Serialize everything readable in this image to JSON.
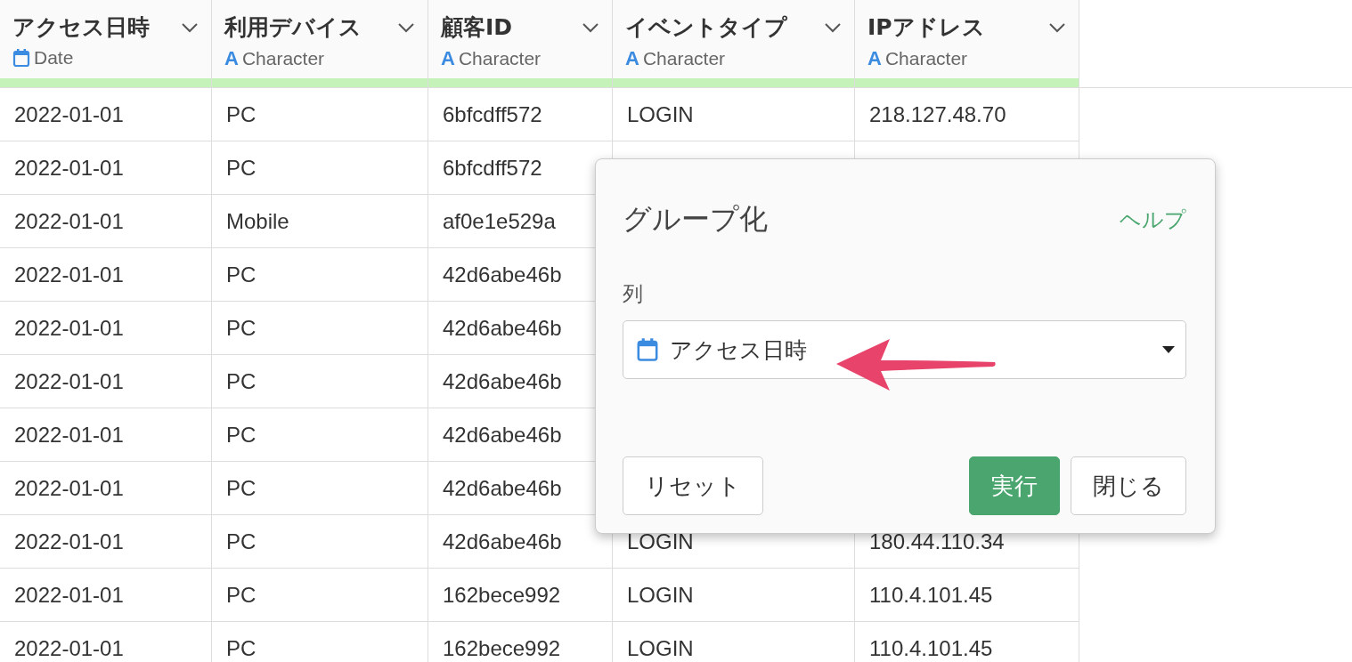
{
  "table": {
    "columns": [
      {
        "label": "アクセス日時",
        "type": "Date",
        "kind": "date"
      },
      {
        "label": "利用デバイス",
        "type": "Character",
        "kind": "character",
        "type_icon": "A"
      },
      {
        "label": "顧客ID",
        "type": "Character",
        "kind": "character",
        "type_icon": "A"
      },
      {
        "label": "イベントタイプ",
        "type": "Character",
        "kind": "character",
        "type_icon": "A"
      },
      {
        "label": "IPアドレス",
        "type": "Character",
        "kind": "character",
        "type_icon": "A"
      }
    ],
    "rows": [
      [
        "2022-01-01",
        "PC",
        "6bfcdff572",
        "LOGIN",
        "218.127.48.70"
      ],
      [
        "2022-01-01",
        "PC",
        "6bfcdff572"
      ],
      [
        "2022-01-01",
        "Mobile",
        "af0e1e529a"
      ],
      [
        "2022-01-01",
        "PC",
        "42d6abe46b"
      ],
      [
        "2022-01-01",
        "PC",
        "42d6abe46b"
      ],
      [
        "2022-01-01",
        "PC",
        "42d6abe46b"
      ],
      [
        "2022-01-01",
        "PC",
        "42d6abe46b"
      ],
      [
        "2022-01-01",
        "PC",
        "42d6abe46b"
      ],
      [
        "2022-01-01",
        "PC",
        "42d6abe46b",
        "LOGIN",
        "180.44.110.34"
      ],
      [
        "2022-01-01",
        "PC",
        "162bece992",
        "LOGIN",
        "110.4.101.45"
      ],
      [
        "2022-01-01",
        "PC",
        "162bece992",
        "LOGIN",
        "110.4.101.45"
      ]
    ]
  },
  "dialog": {
    "title": "グループ化",
    "help": "ヘルプ",
    "field_label": "列",
    "select": {
      "value": "アクセス日時",
      "kind": "date"
    },
    "buttons": [
      {
        "label": "リセット",
        "kind": "default"
      },
      {
        "label": "実行",
        "kind": "primary"
      },
      {
        "label": "閉じる",
        "kind": "default"
      }
    ]
  }
}
